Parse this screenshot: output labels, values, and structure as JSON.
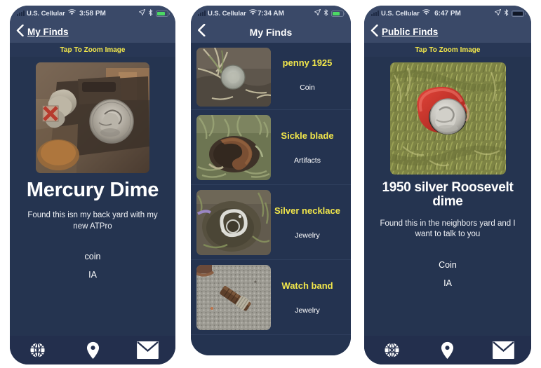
{
  "colors": {
    "body_bg": "#253450",
    "nav_bg": "#3a4968",
    "accent_yellow": "#f2e74b",
    "tabbar_bg": "#232f4d",
    "text_white": "#ffffff"
  },
  "screens": [
    {
      "id": "find-detail-mercury-dime",
      "status_bar": {
        "carrier": "U.S. Cellular",
        "time": "3:58 PM",
        "signal_icon": "signal-bars-icon",
        "wifi_icon": "wifi-icon",
        "location_icon": "location-arrow-icon",
        "bluetooth_icon": "bluetooth-icon",
        "battery_icon": "battery-icon",
        "battery_color": "#4cd964",
        "battery_level": 80
      },
      "nav": {
        "back_icon": "chevron-left-icon",
        "back_label": "My Finds",
        "title": ""
      },
      "zoom_hint": "Tap To Zoom Image",
      "photo_name": "find-photo-mercury-dime",
      "title": "Mercury Dime",
      "description": "Found this isn my back yard with my new ATPro",
      "category": "coin",
      "location": "IA",
      "tabbar": [
        {
          "icon": "globe-icon",
          "name": "tab-public-finds"
        },
        {
          "icon": "map-pin-icon",
          "name": "tab-map"
        },
        {
          "icon": "envelope-icon",
          "name": "tab-messages"
        }
      ]
    },
    {
      "id": "my-finds-list",
      "status_bar": {
        "carrier": "U.S. Cellular",
        "time": "7:34 AM",
        "signal_icon": "signal-bars-icon",
        "wifi_icon": "wifi-icon",
        "location_icon": "location-arrow-icon",
        "bluetooth_icon": "bluetooth-icon",
        "battery_icon": "battery-icon",
        "battery_color": "#4cd964",
        "battery_level": 70
      },
      "nav": {
        "back_icon": "chevron-left-icon",
        "back_label": "",
        "title": "My Finds"
      },
      "rows": [
        {
          "title": "penny 1925",
          "category": "Coin",
          "photo_name": "find-photo-penny-1925"
        },
        {
          "title": "Sickle blade",
          "category": "Artifacts",
          "photo_name": "find-photo-sickle-blade"
        },
        {
          "title": "Silver necklace",
          "category": "Jewelry",
          "photo_name": "find-photo-silver-necklace"
        },
        {
          "title": "Watch band",
          "category": "Jewelry",
          "photo_name": "find-photo-watch-band"
        }
      ]
    },
    {
      "id": "find-detail-roosevelt-dime",
      "status_bar": {
        "carrier": "U.S. Cellular",
        "time": "6:47 PM",
        "signal_icon": "signal-bars-icon",
        "wifi_icon": "wifi-icon",
        "location_icon": "location-arrow-icon",
        "bluetooth_icon": "bluetooth-icon",
        "battery_icon": "battery-icon",
        "battery_color": "#101726",
        "battery_level": 100
      },
      "nav": {
        "back_icon": "chevron-left-icon",
        "back_label": "Public Finds",
        "title": ""
      },
      "zoom_hint": "Tap To Zoom Image",
      "photo_name": "find-photo-roosevelt-dime",
      "title": "1950 silver Roosevelt dime",
      "description": "Found this in the neighbors yard and I want to talk to you",
      "category": "Coin",
      "location": "IA",
      "tabbar": [
        {
          "icon": "globe-icon",
          "name": "tab-public-finds"
        },
        {
          "icon": "map-pin-icon",
          "name": "tab-map"
        },
        {
          "icon": "envelope-icon",
          "name": "tab-messages"
        }
      ]
    }
  ]
}
